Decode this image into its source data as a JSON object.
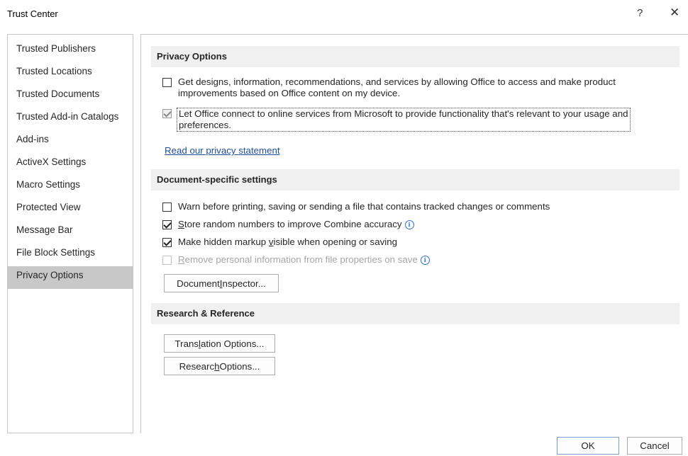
{
  "window": {
    "title": "Trust Center",
    "help_glyph": "?",
    "close_glyph": "✕"
  },
  "sidebar": {
    "items": [
      {
        "label": "Trusted Publishers"
      },
      {
        "label": "Trusted Locations"
      },
      {
        "label": "Trusted Documents"
      },
      {
        "label": "Trusted Add-in Catalogs"
      },
      {
        "label": "Add-ins"
      },
      {
        "label": "ActiveX Settings"
      },
      {
        "label": "Macro Settings"
      },
      {
        "label": "Protected View"
      },
      {
        "label": "Message Bar"
      },
      {
        "label": "File Block Settings"
      },
      {
        "label": "Privacy Options"
      }
    ],
    "selected": "Privacy Options"
  },
  "privacy": {
    "header": "Privacy Options",
    "opt1_line1": "Get designs, information, recommendations, and services by allowing Office to access and make product",
    "opt1_line2": "improvements based on Office content on my device.",
    "opt1_checked": false,
    "opt2_line1": "Let Office connect to online services from Microsoft to provide functionality that's relevant to your usage and",
    "opt2_line2": "preferences.",
    "opt2_checked": true,
    "link": "Read our privacy statement"
  },
  "document": {
    "header": "Document-specific settings",
    "opt1_a": "Warn before ",
    "opt1_u": "p",
    "opt1_b": "rinting, saving or sending a file that contains tracked changes or comments",
    "opt1_checked": false,
    "opt2_a": "",
    "opt2_u": "S",
    "opt2_b": "tore random numbers to improve Combine accuracy",
    "opt2_checked": true,
    "opt3_a": "Make hidden markup ",
    "opt3_u": "v",
    "opt3_b": "isible when opening or saving",
    "opt3_checked": true,
    "opt4_a": "",
    "opt4_u": "R",
    "opt4_b": "emove personal information from file properties on save",
    "opt4_checked": false,
    "opt4_disabled": true,
    "inspector_a": "Document ",
    "inspector_u": "I",
    "inspector_b": "nspector..."
  },
  "research": {
    "header": "Research & Reference",
    "translation_a": "Trans",
    "translation_u": "l",
    "translation_b": "ation Options...",
    "research_a": "Researc",
    "research_u": "h",
    "research_b": " Options..."
  },
  "footer": {
    "ok": "OK",
    "cancel": "Cancel"
  },
  "info_glyph": "i",
  "colors": {
    "accent_link": "#1e4e9b",
    "info": "#2b6fce",
    "selected_bg": "#c8c8c8",
    "section_bg": "#f0f0f0"
  }
}
